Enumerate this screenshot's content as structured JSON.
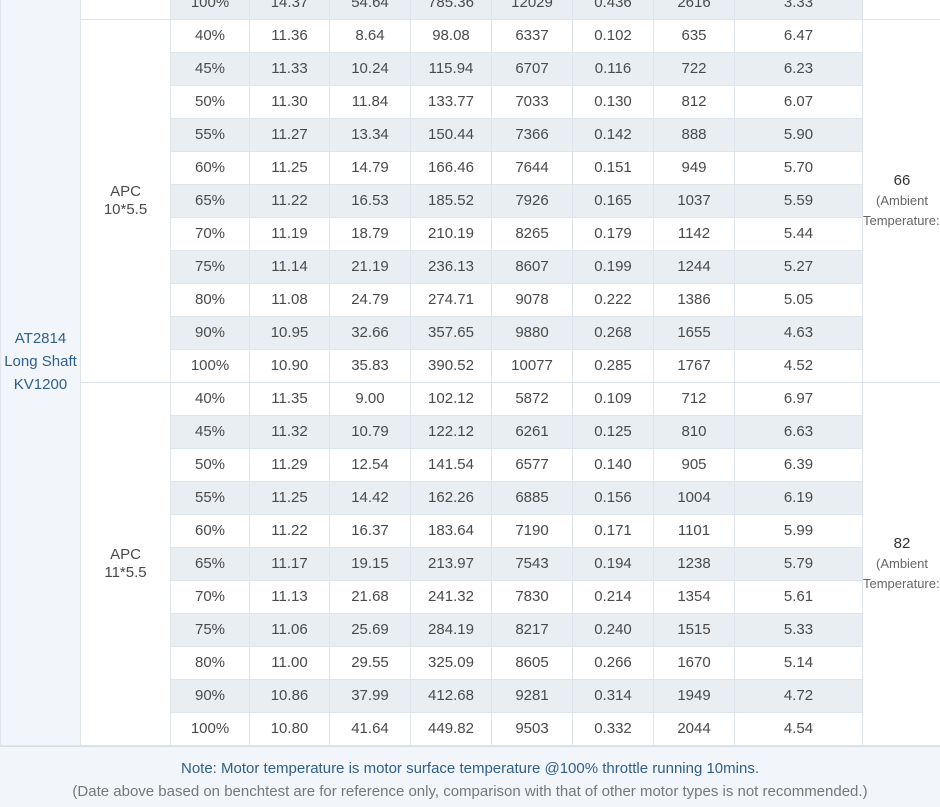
{
  "motor": {
    "model_fragment": "AT2814",
    "variant": "Long Shaft",
    "kv": "KV1200"
  },
  "top_partial_row": {
    "throttle": "100%",
    "voltage": "14.37",
    "current": "54.64",
    "power": "785.36",
    "rpm": "12029",
    "torque": "0.436",
    "thrust": "2616",
    "efficiency": "3.33"
  },
  "groups": [
    {
      "prop_brand": "APC",
      "prop_size": "10*5.5",
      "temperature": "66",
      "temperature_note": "(Ambient Temperature:/)",
      "rows": [
        [
          "40%",
          "11.36",
          "8.64",
          "98.08",
          "6337",
          "0.102",
          "635",
          "6.47"
        ],
        [
          "45%",
          "11.33",
          "10.24",
          "115.94",
          "6707",
          "0.116",
          "722",
          "6.23"
        ],
        [
          "50%",
          "11.30",
          "11.84",
          "133.77",
          "7033",
          "0.130",
          "812",
          "6.07"
        ],
        [
          "55%",
          "11.27",
          "13.34",
          "150.44",
          "7366",
          "0.142",
          "888",
          "5.90"
        ],
        [
          "60%",
          "11.25",
          "14.79",
          "166.46",
          "7644",
          "0.151",
          "949",
          "5.70"
        ],
        [
          "65%",
          "11.22",
          "16.53",
          "185.52",
          "7926",
          "0.165",
          "1037",
          "5.59"
        ],
        [
          "70%",
          "11.19",
          "18.79",
          "210.19",
          "8265",
          "0.179",
          "1142",
          "5.44"
        ],
        [
          "75%",
          "11.14",
          "21.19",
          "236.13",
          "8607",
          "0.199",
          "1244",
          "5.27"
        ],
        [
          "80%",
          "11.08",
          "24.79",
          "274.71",
          "9078",
          "0.222",
          "1386",
          "5.05"
        ],
        [
          "90%",
          "10.95",
          "32.66",
          "357.65",
          "9880",
          "0.268",
          "1655",
          "4.63"
        ],
        [
          "100%",
          "10.90",
          "35.83",
          "390.52",
          "10077",
          "0.285",
          "1767",
          "4.52"
        ]
      ]
    },
    {
      "prop_brand": "APC",
      "prop_size": "11*5.5",
      "temperature": "82",
      "temperature_note": "(Ambient Temperature:/)",
      "rows": [
        [
          "40%",
          "11.35",
          "9.00",
          "102.12",
          "5872",
          "0.109",
          "712",
          "6.97"
        ],
        [
          "45%",
          "11.32",
          "10.79",
          "122.12",
          "6261",
          "0.125",
          "810",
          "6.63"
        ],
        [
          "50%",
          "11.29",
          "12.54",
          "141.54",
          "6577",
          "0.140",
          "905",
          "6.39"
        ],
        [
          "55%",
          "11.25",
          "14.42",
          "162.26",
          "6885",
          "0.156",
          "1004",
          "6.19"
        ],
        [
          "60%",
          "11.22",
          "16.37",
          "183.64",
          "7190",
          "0.171",
          "1101",
          "5.99"
        ],
        [
          "65%",
          "11.17",
          "19.15",
          "213.97",
          "7543",
          "0.194",
          "1238",
          "5.79"
        ],
        [
          "70%",
          "11.13",
          "21.68",
          "241.32",
          "7830",
          "0.214",
          "1354",
          "5.61"
        ],
        [
          "75%",
          "11.06",
          "25.69",
          "284.19",
          "8217",
          "0.240",
          "1515",
          "5.33"
        ],
        [
          "80%",
          "11.00",
          "29.55",
          "325.09",
          "8605",
          "0.266",
          "1670",
          "5.14"
        ],
        [
          "90%",
          "10.86",
          "37.99",
          "412.68",
          "9281",
          "0.314",
          "1949",
          "4.72"
        ],
        [
          "100%",
          "10.80",
          "41.64",
          "449.82",
          "9503",
          "0.332",
          "2044",
          "4.54"
        ]
      ]
    }
  ],
  "footer": {
    "note": "Note: Motor temperature is motor surface temperature @100% throttle running 10mins.",
    "disclaimer": "(Date above based on benchtest are for reference only, comparison with that of other motor types is not recommended.)"
  },
  "colors": {
    "row_shade": "#e9eef3",
    "side_bg": "#f2f6fa",
    "motor_text": "#2f5f8a",
    "border": "#dfe5ec"
  }
}
